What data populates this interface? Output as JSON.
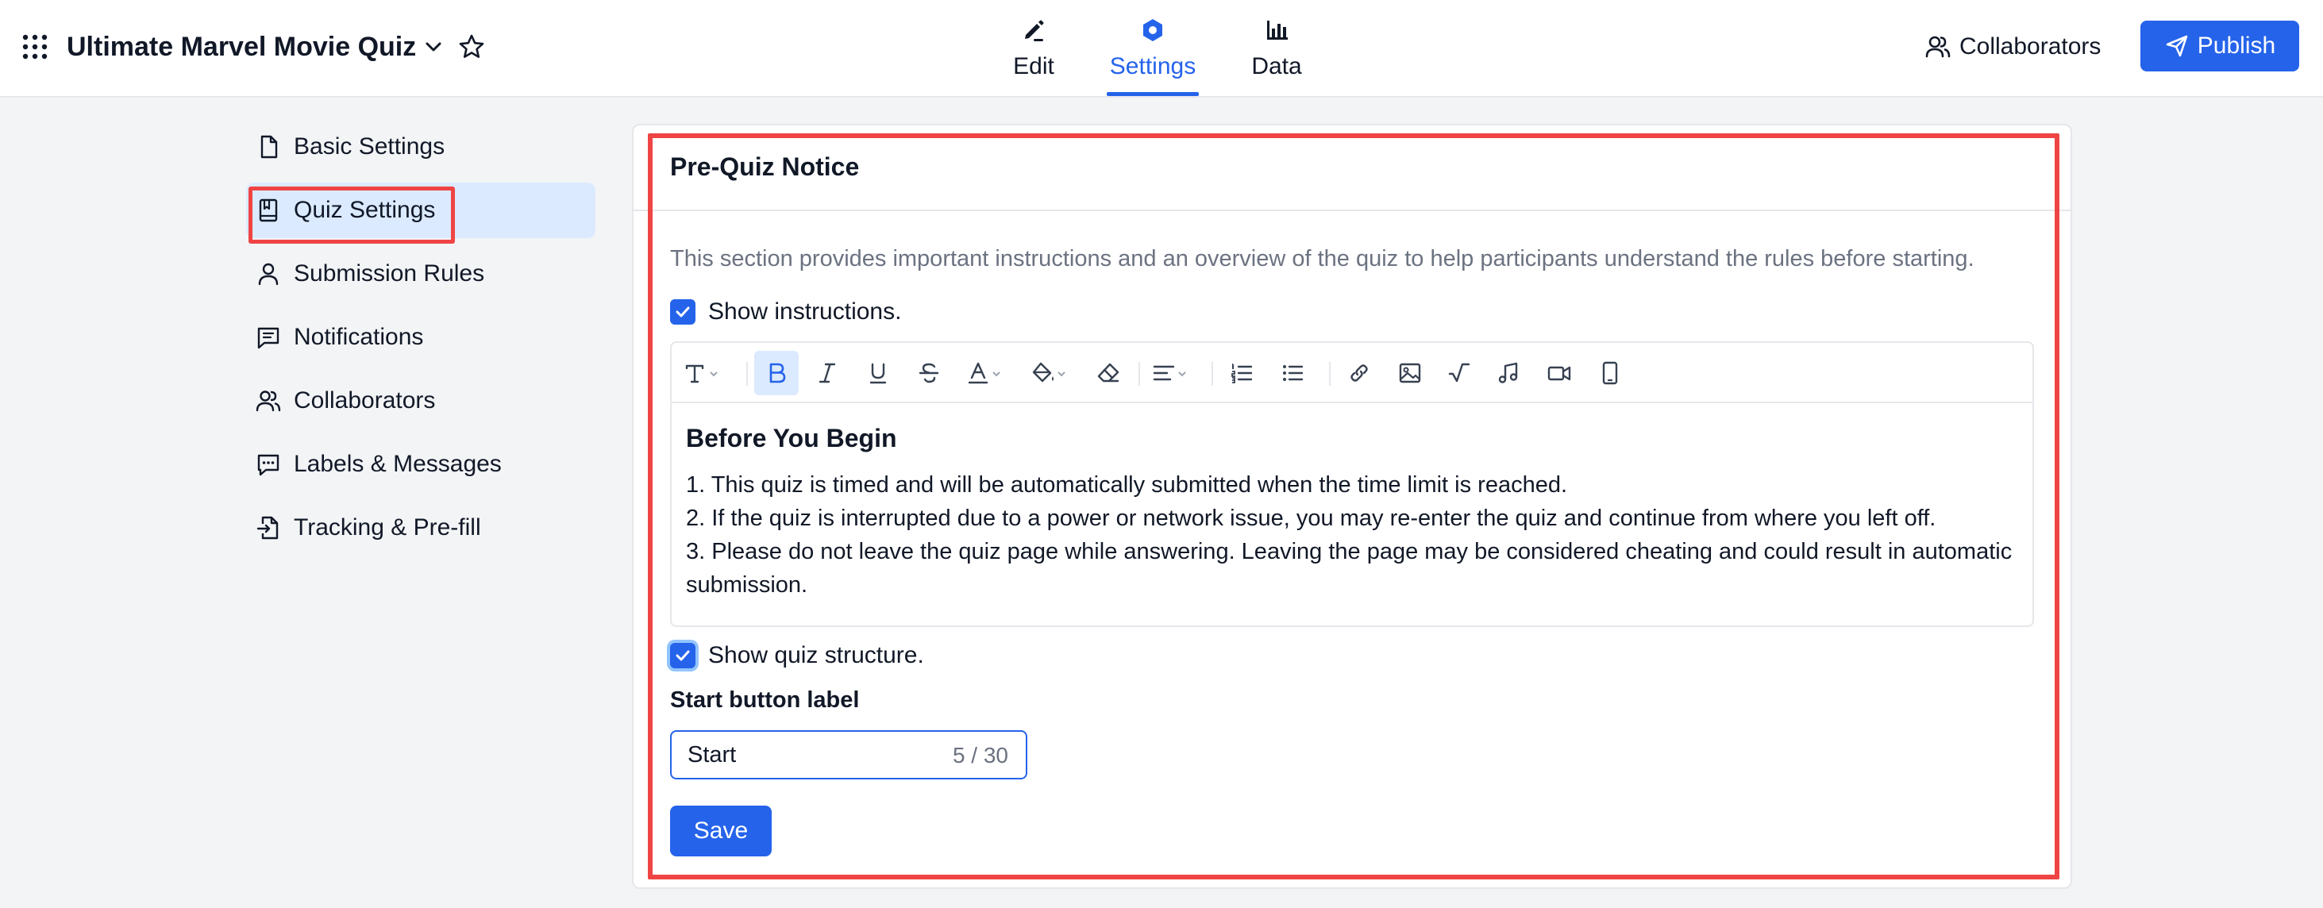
{
  "header": {
    "app_title": "Ultimate Marvel Movie Quiz",
    "tabs": [
      {
        "label": "Edit",
        "icon": "edit-icon"
      },
      {
        "label": "Settings",
        "icon": "settings-icon",
        "active": true
      },
      {
        "label": "Data",
        "icon": "bar-chart-icon"
      }
    ],
    "collaborators_label": "Collaborators",
    "publish_label": "Publish"
  },
  "sidebar": {
    "items": [
      {
        "label": "Basic Settings",
        "icon": "file-icon"
      },
      {
        "label": "Quiz Settings",
        "icon": "quiz-book-icon",
        "active": true
      },
      {
        "label": "Submission Rules",
        "icon": "user-icon"
      },
      {
        "label": "Notifications",
        "icon": "message-icon"
      },
      {
        "label": "Collaborators",
        "icon": "users-icon"
      },
      {
        "label": "Labels & Messages",
        "icon": "chat-icon"
      },
      {
        "label": "Tracking & Pre-fill",
        "icon": "file-import-icon"
      }
    ]
  },
  "main": {
    "title": "Pre-Quiz Notice",
    "description": "This section provides important instructions and an overview of the quiz to help participants understand the rules before starting.",
    "show_instructions": {
      "label": "Show instructions.",
      "checked": true
    },
    "editor": {
      "heading": "Before You Begin",
      "lines": [
        "1. This quiz is timed and will be automatically submitted when the time limit is reached.",
        "2. If the quiz is interrupted due to a power or network issue, you may re-enter the quiz and continue from where you left off.",
        "3. Please do not leave the quiz page while answering. Leaving the page may be considered cheating and could result in automatic submission."
      ]
    },
    "show_structure": {
      "label": "Show quiz structure.",
      "checked": true
    },
    "start_button": {
      "label": "Start button label",
      "value": "Start",
      "count": "5 / 30"
    },
    "save_label": "Save"
  },
  "colors": {
    "accent": "#2563eb",
    "active_bg": "#dbeafe",
    "highlight": "#ef4444"
  }
}
